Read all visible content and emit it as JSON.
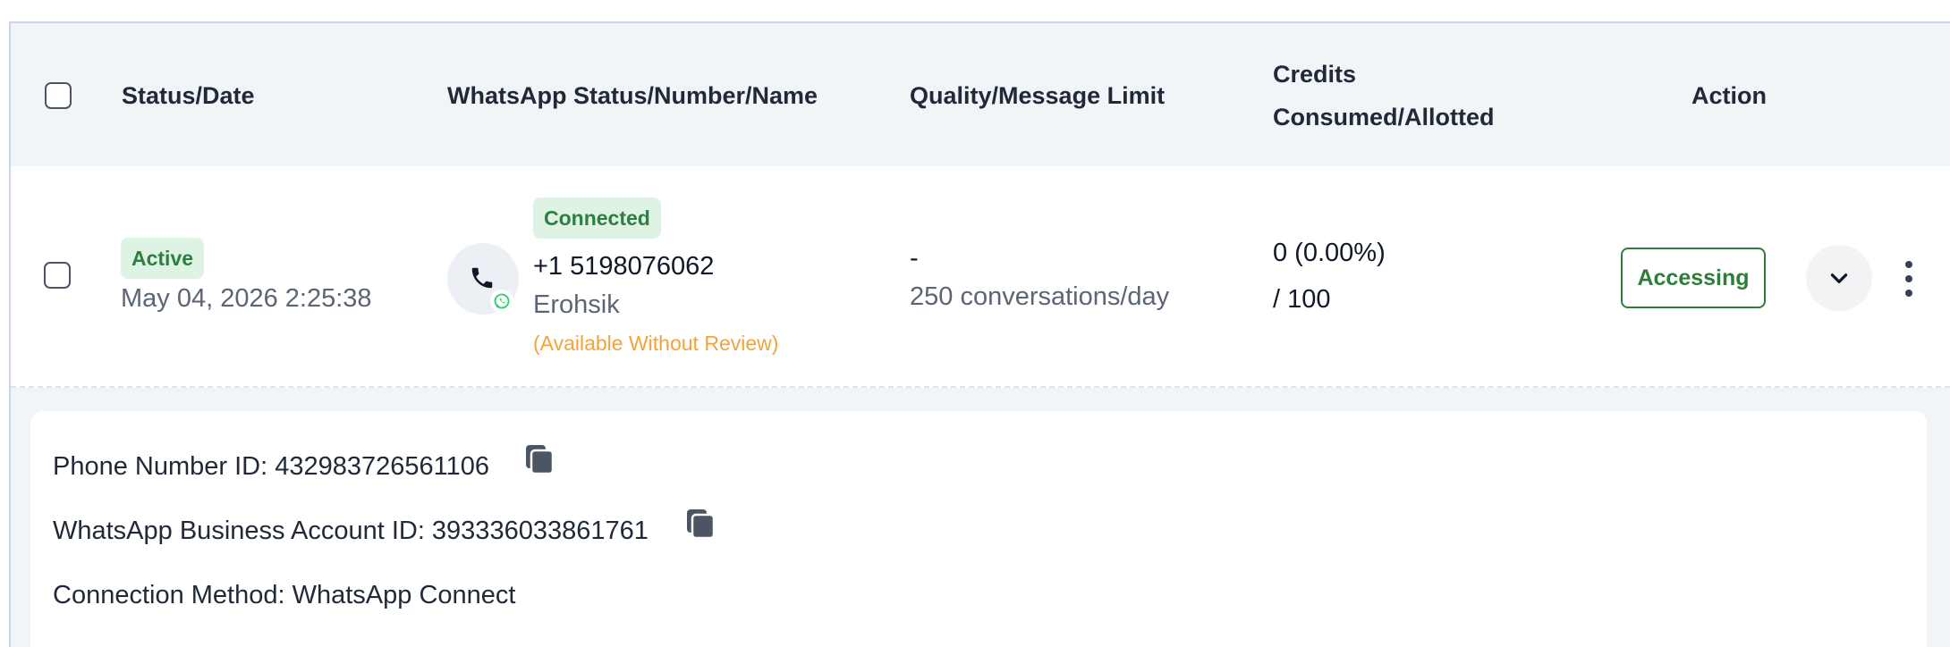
{
  "table": {
    "headers": {
      "status_date": "Status/Date",
      "whatsapp": "WhatsApp Status/Number/Name",
      "quality": "Quality/Message Limit",
      "credits_line1": "Credits",
      "credits_line2": "Consumed/Allotted",
      "action": "Action"
    },
    "row": {
      "status": "Active",
      "date": "May 04, 2026 2:25:38",
      "wa_status": "Connected",
      "number": "+1 5198076062",
      "name": "Erohsik",
      "review_note": "(Available Without Review)",
      "quality": "-",
      "message_limit": "250 conversations/day",
      "credits_consumed": "0 (0.00%)",
      "credits_allotted": "/ 100",
      "action_label": "Accessing"
    }
  },
  "details": {
    "phone_number_id": "Phone Number ID: 432983726561106",
    "waba_id": "WhatsApp Business Account ID: 393336033861761",
    "connection_method": "Connection Method: WhatsApp Connect"
  },
  "icons": {
    "select": "checkbox",
    "phone": "phone-icon",
    "whatsapp": "whatsapp-icon",
    "expand": "chevron-down-icon",
    "more": "kebab-menu-icon",
    "copy": "copy-icon"
  },
  "colors": {
    "active_green": "#2f7d43",
    "badge_bg": "#dff3e4",
    "warning_orange": "#f2a33a",
    "header_bg": "#f2f5f8"
  }
}
